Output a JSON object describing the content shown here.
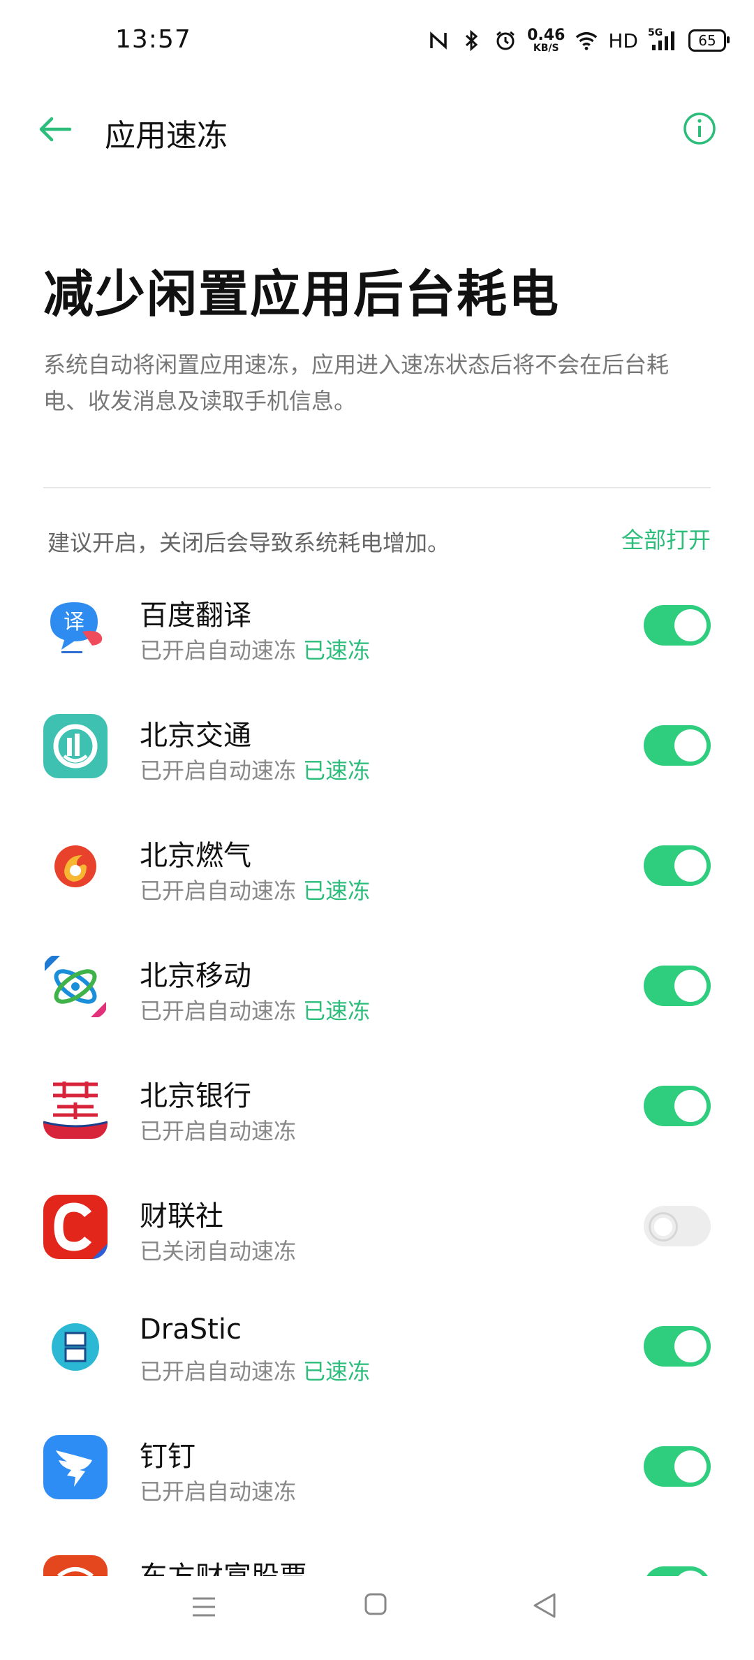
{
  "status_bar": {
    "time": "13:57",
    "net_speed_value": "0.46",
    "net_speed_unit": "KB/S",
    "hd_label": "HD",
    "signal_label": "5G",
    "battery": "65"
  },
  "app_bar": {
    "title": "应用速冻"
  },
  "hero": {
    "title": "减少闲置应用后台耗电",
    "description": "系统自动将闲置应用速冻，应用进入速冻状态后将不会在后台耗电、收发消息及读取手机信息。"
  },
  "section": {
    "note": "建议开启，关闭后会导致系统耗电增加。",
    "all_on_label": "全部打开"
  },
  "apps": [
    {
      "name": "百度翻译",
      "status": "已开启自动速冻",
      "tag": "已速冻",
      "enabled": true
    },
    {
      "name": "北京交通",
      "status": "已开启自动速冻",
      "tag": "已速冻",
      "enabled": true
    },
    {
      "name": "北京燃气",
      "status": "已开启自动速冻",
      "tag": "已速冻",
      "enabled": true
    },
    {
      "name": "北京移动",
      "status": "已开启自动速冻",
      "tag": "已速冻",
      "enabled": true
    },
    {
      "name": "北京银行",
      "status": "已开启自动速冻",
      "tag": "",
      "enabled": true
    },
    {
      "name": "财联社",
      "status": "已关闭自动速冻",
      "tag": "",
      "enabled": false
    },
    {
      "name": "DraStic",
      "status": "已开启自动速冻",
      "tag": "已速冻",
      "enabled": true
    },
    {
      "name": "钉钉",
      "status": "已开启自动速冻",
      "tag": "",
      "enabled": true
    },
    {
      "name": "东方财富股票",
      "status": "",
      "tag": "",
      "enabled": true
    }
  ],
  "icons": {
    "back": "arrow-left-icon",
    "info": "info-circle-icon",
    "nav_menu": "menu-icon",
    "nav_home": "home-square-icon",
    "nav_back": "back-triangle-icon"
  },
  "colors": {
    "accent": "#2cbd7b",
    "toggle_on": "#2fcd7e",
    "toggle_off": "#ededed"
  }
}
